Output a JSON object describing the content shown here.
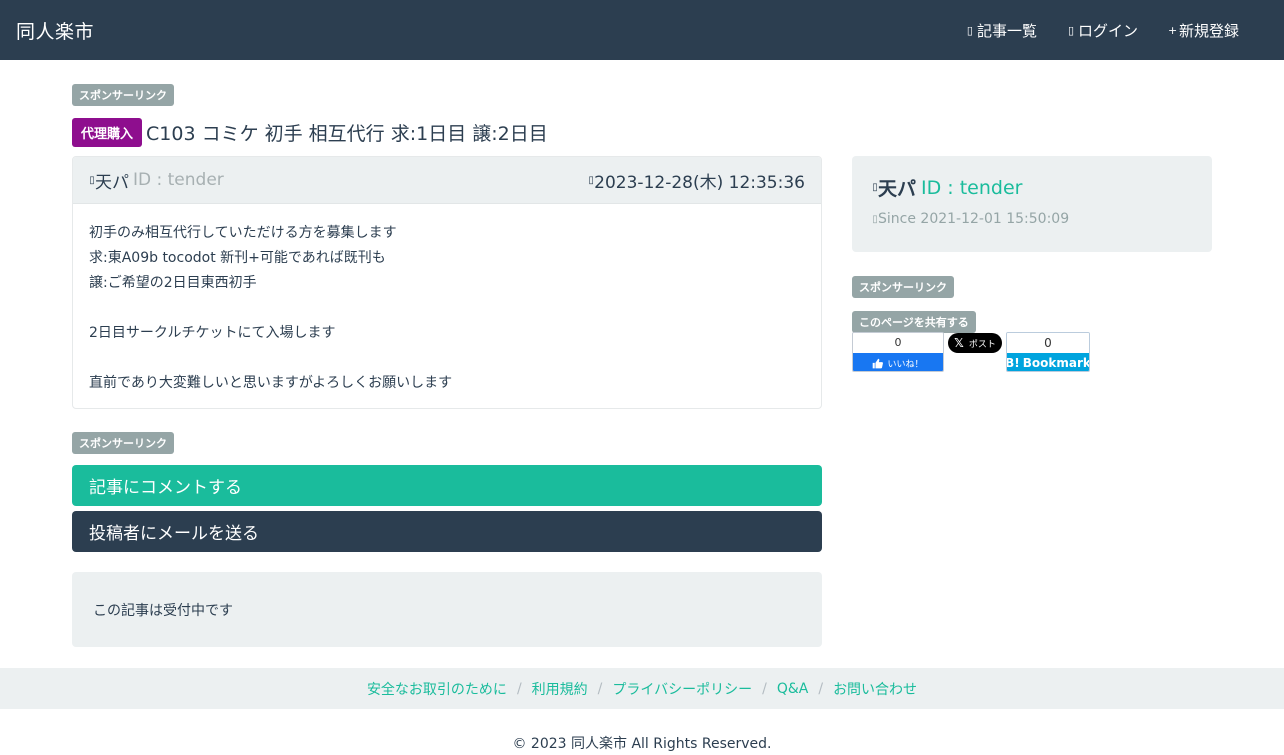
{
  "navbar": {
    "brand": "同人楽市",
    "links": [
      {
        "icon": "list-icon",
        "glyph": "▯",
        "label": "記事一覧"
      },
      {
        "icon": "login-icon",
        "glyph": "▯",
        "label": "ログイン"
      },
      {
        "icon": "plus-icon",
        "glyph": "+",
        "label": "新規登録"
      }
    ]
  },
  "sponsor_label": "スポンサーリンク",
  "post": {
    "category": "代理購入",
    "title": "C103 コミケ 初手 相互代行 求:1日目 譲:2日目",
    "author_name": "天パ",
    "author_id": "ID : tender",
    "date": "2023-12-28(木) 12:35:36",
    "body_lines": [
      "初手のみ相互代行していただける方を募集します",
      "求:東A09b tocodot 新刊+可能であれば既刊も",
      "譲:ご希望の2日目東西初手",
      "",
      "2日目サークルチケットにて入場します",
      "",
      "直前であり大変難しいと思いますがよろしくお願いします"
    ]
  },
  "actions": {
    "comment_label": "記事にコメントする",
    "mail_label": "投稿者にメールを送る"
  },
  "status_text": "この記事は受付中です",
  "profile": {
    "name": "天パ",
    "id": "ID : tender",
    "since": "Since 2021-12-01 15:50:09"
  },
  "share": {
    "label": "このページを共有する",
    "fb_count": "0",
    "fb_label": "いいね！",
    "x_label": "ポスト",
    "hb_count": "0",
    "hb_label": "Bookmark"
  },
  "footer": {
    "links": [
      "安全なお取引のために",
      "利用規約",
      "プライバシーポリシー",
      "Q&A",
      "お問い合わせ"
    ],
    "copyright": "© 2023 同人楽市 All Rights Reserved."
  },
  "colors": {
    "navbar": "#2c3e50",
    "accent": "#1abc9c",
    "category": "#8e0e8e",
    "badge": "#95a5a6",
    "panel": "#ecf0f1"
  }
}
